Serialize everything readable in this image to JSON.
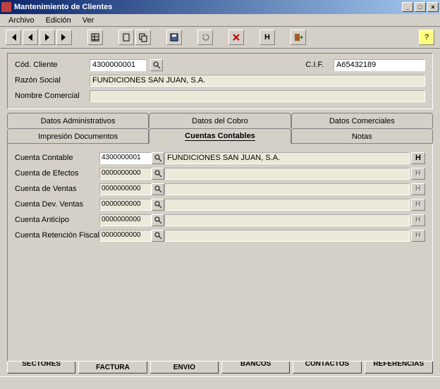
{
  "window": {
    "title": "Mantenimiento de Clientes"
  },
  "menu": {
    "archivo": "Archivo",
    "edicion": "Edición",
    "ver": "Ver"
  },
  "header": {
    "cod_label": "Cód. Cliente",
    "cod_value": "4300000001",
    "cif_label": "C.I.F.",
    "cif_value": "A65432189",
    "razon_label": "Razón Social",
    "razon_value": "FUNDICIONES SAN JUAN, S.A.",
    "nombre_label": "Nombre Comercial",
    "nombre_value": ""
  },
  "tabs": {
    "row1": [
      "Datos Administrativos",
      "Datos del Cobro",
      "Datos Comerciales"
    ],
    "row2": [
      "Impresión Documentos",
      "Cuentas Contables",
      "Notas"
    ]
  },
  "accounts": [
    {
      "label": "Cuenta Contable",
      "code": "4300000001",
      "desc": "FUNDICIONES SAN JUAN, S.A.",
      "enabled": true
    },
    {
      "label": "Cuenta de Efectos",
      "code": "0000000000",
      "desc": "",
      "enabled": false
    },
    {
      "label": "Cuenta de Ventas",
      "code": "0000000000",
      "desc": "",
      "enabled": false
    },
    {
      "label": "Cuenta Dev. Ventas",
      "code": "0000000000",
      "desc": "",
      "enabled": false
    },
    {
      "label": "Cuenta Anticipo",
      "code": "0000000000",
      "desc": "",
      "enabled": false
    },
    {
      "label": "Cuenta Retención Fiscal",
      "code": "0000000000",
      "desc": "",
      "enabled": false
    }
  ],
  "buttons": {
    "sectores": "SECTORES",
    "dir_factura": "DIRECCIONES DE FACTURA",
    "dir_envio": "DIRECCIONES DE ENVIO",
    "bancos": "BANCOS",
    "contactos": "CONTACTOS",
    "referencias": "REFERENCIAS"
  },
  "icons": {
    "h_label": "H"
  }
}
